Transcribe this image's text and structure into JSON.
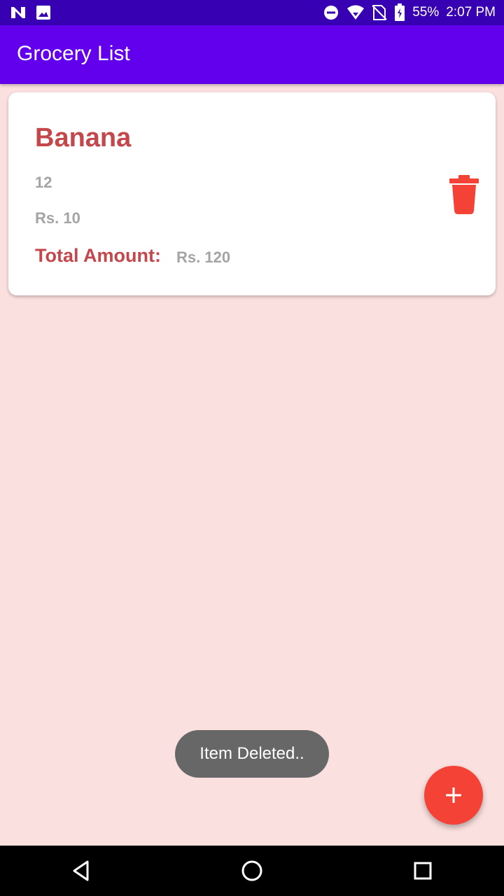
{
  "status_bar": {
    "battery": "55%",
    "time": "2:07 PM",
    "icons": [
      "notification-n-icon",
      "image-icon",
      "do-not-disturb-icon",
      "wifi-icon",
      "no-sim-icon",
      "battery-icon"
    ]
  },
  "app_bar": {
    "title": "Grocery List",
    "color": "#6200ee"
  },
  "items": [
    {
      "name": "Banana",
      "quantity": "12",
      "rate": "Rs. 10",
      "total_label": "Total Amount:",
      "total_value": "Rs. 120"
    }
  ],
  "toast": {
    "message": "Item Deleted.."
  },
  "fab": {
    "icon": "plus-icon",
    "color": "#f44336"
  },
  "nav_bar": {
    "icons": [
      "back-icon",
      "home-icon",
      "recents-icon"
    ]
  },
  "colors": {
    "background": "#fae0de",
    "accent_text": "#c4474b",
    "muted_text": "#a4a4a4",
    "delete": "#f44336"
  }
}
